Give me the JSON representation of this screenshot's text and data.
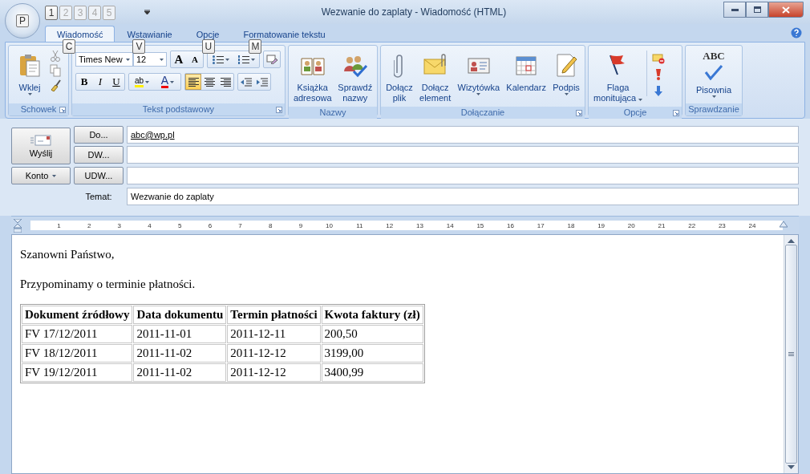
{
  "window": {
    "title": "Wezwanie do zaplaty - Wiadomość (HTML)"
  },
  "office_keytip": "P",
  "quick_access_keytips": [
    {
      "label": "1",
      "disabled": false
    },
    {
      "label": "2",
      "disabled": true
    },
    {
      "label": "3",
      "disabled": true
    },
    {
      "label": "4",
      "disabled": true
    },
    {
      "label": "5",
      "disabled": true
    }
  ],
  "tabs": [
    {
      "label": "Wiadomość",
      "selected": true,
      "keytip": "C"
    },
    {
      "label": "Wstawianie",
      "selected": false,
      "keytip": "V"
    },
    {
      "label": "Opcje",
      "selected": false,
      "keytip": "U"
    },
    {
      "label": "Formatowanie tekstu",
      "selected": false,
      "keytip": "M"
    }
  ],
  "ribbon": {
    "clipboard": {
      "label": "Schowek",
      "paste": "Wklej"
    },
    "basic_text": {
      "label": "Tekst podstawowy",
      "font": "Times New",
      "size": "12",
      "grow": "A",
      "shrink": "A",
      "bold": "B",
      "italic": "I",
      "underline": "U",
      "highlight": "ab",
      "font_color": "A",
      "alignment": [
        {
          "selected": true
        },
        {
          "selected": false
        },
        {
          "selected": false
        }
      ]
    },
    "names": {
      "label": "Nazwy",
      "buttons": [
        {
          "lines": [
            "Książka",
            "adresowa"
          ]
        },
        {
          "lines": [
            "Sprawdź",
            "nazwy"
          ]
        }
      ]
    },
    "attach": {
      "label": "Dołączanie",
      "buttons": [
        {
          "lines": [
            "Dołącz",
            "plik"
          ]
        },
        {
          "lines": [
            "Dołącz",
            "element"
          ]
        },
        {
          "lines": [
            "Wizytówka"
          ]
        },
        {
          "lines": [
            "Kalendarz"
          ]
        },
        {
          "lines": [
            "Podpis"
          ]
        }
      ]
    },
    "options": {
      "label": "Opcje",
      "flag": [
        "Flaga",
        "monitująca"
      ]
    },
    "proofing": {
      "label": "Sprawdzanie",
      "spelling": "Pisownia",
      "icon_text": "ABC"
    }
  },
  "send_button": "Wyślij",
  "account_button": "Konto",
  "address_rows": [
    {
      "button": "Do...",
      "value": "abc@wp.pl"
    },
    {
      "button": "DW..."
    },
    {
      "button": "UDW..."
    }
  ],
  "subject": {
    "label": "Temat:",
    "value": "Wezwanie do zaplaty"
  },
  "ruler": [
    "1",
    "2",
    "3",
    "4",
    "5",
    "6",
    "7",
    "8",
    "9",
    "10",
    "11",
    "12",
    "13",
    "14",
    "15",
    "16",
    "17",
    "18",
    "19",
    "20",
    "21",
    "22",
    "23",
    "24"
  ],
  "message": {
    "paragraphs": [
      "Szanowni Państwo,",
      "Przypominamy o terminie płatności."
    ],
    "table": {
      "columns": [
        "Dokument źródłowy",
        "Data dokumentu",
        "Termin płatności",
        "Kwota faktury (zł)"
      ],
      "rows": [
        [
          "FV 17/12/2011",
          "2011-11-01",
          "2011-12-11",
          "200,50"
        ],
        [
          "FV 18/12/2011",
          "2011-11-02",
          "2011-12-12",
          "3199,00"
        ],
        [
          "FV 19/12/2011",
          "2011-11-02",
          "2011-12-12",
          "3400,99"
        ]
      ]
    }
  }
}
